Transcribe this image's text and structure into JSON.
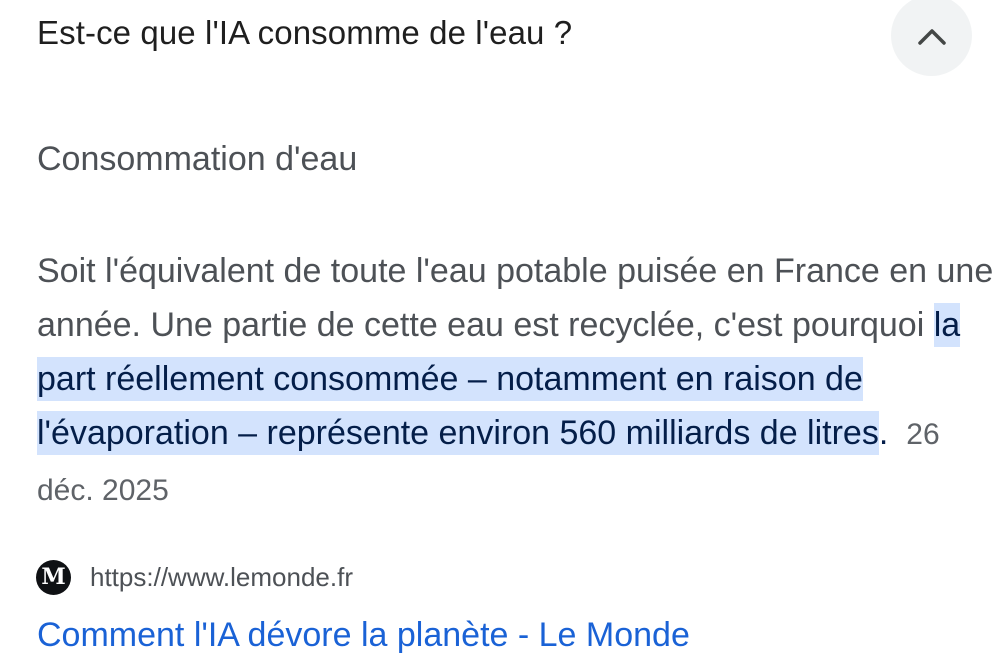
{
  "question": "Est-ce que l'IA consomme de l'eau ?",
  "collapse_icon": "chevron-up-icon",
  "section_title": "Consommation d'eau",
  "answer": {
    "before": "Soit l'équivalent de toute l'eau potable puisée en France en une année. Une partie de cette eau est recyclée, c'est pourquoi ",
    "highlight": "la part réellement consommée – notamment en raison de l'évaporation – représente environ 560 milliards de litres",
    "period": ".",
    "date": "26 déc. 2025"
  },
  "source": {
    "favicon_letter": "M",
    "url": "https://www.lemonde.fr",
    "link_text": "Comment l'IA dévore la planète - Le Monde"
  },
  "colors": {
    "highlight_bg": "#d3e3fd",
    "highlight_text": "#041e49",
    "link": "#1a62d6",
    "button_bg": "#f1f3f4"
  }
}
